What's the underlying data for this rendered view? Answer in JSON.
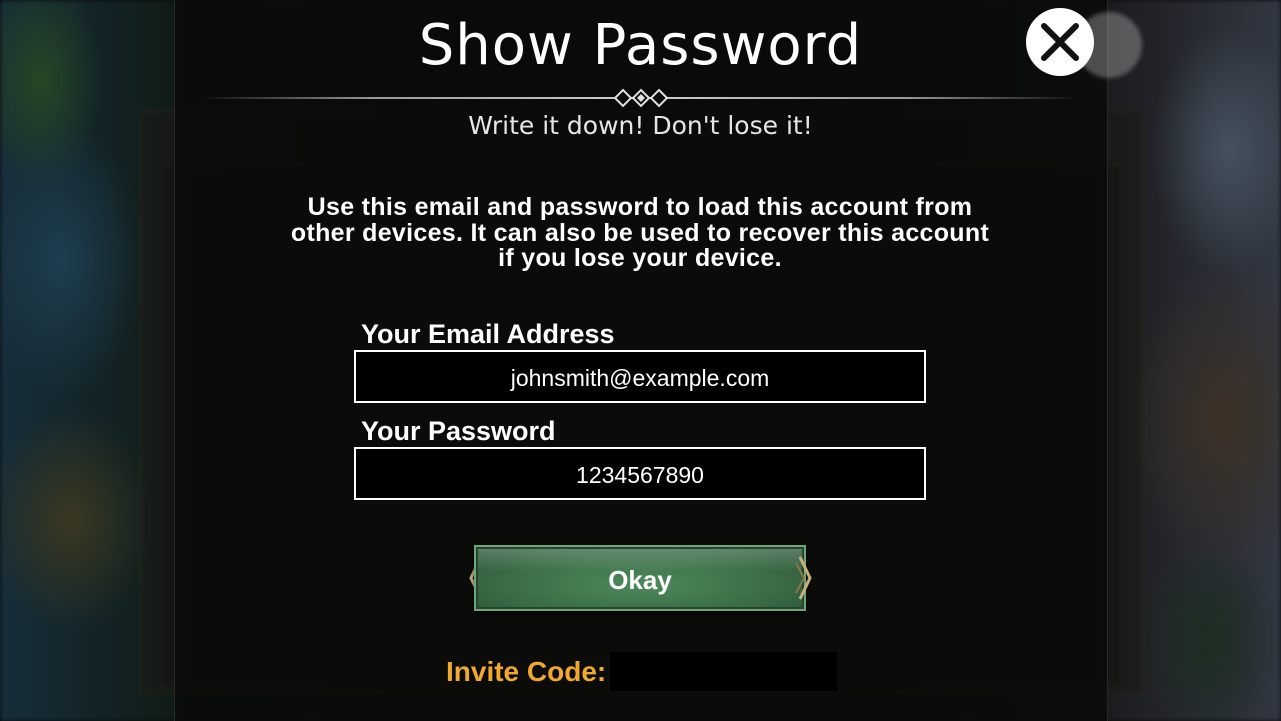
{
  "dialog": {
    "title": "Show Password",
    "subtitle": "Write it down! Don't lose it!",
    "description": "Use this email and password to load this account from other devices. It can also be used to recover this account if you lose your device.",
    "close_icon": "close-icon"
  },
  "email": {
    "label": "Your Email Address",
    "value": "johnsmith@example.com"
  },
  "password": {
    "label": "Your Password",
    "value": "1234567890"
  },
  "okay_button": {
    "label": "Okay"
  },
  "invite": {
    "label": "Invite Code:",
    "value": ""
  },
  "colors": {
    "invite_label": "#f0a92b",
    "button_green": "#3b6e47",
    "text": "#ffffff"
  }
}
